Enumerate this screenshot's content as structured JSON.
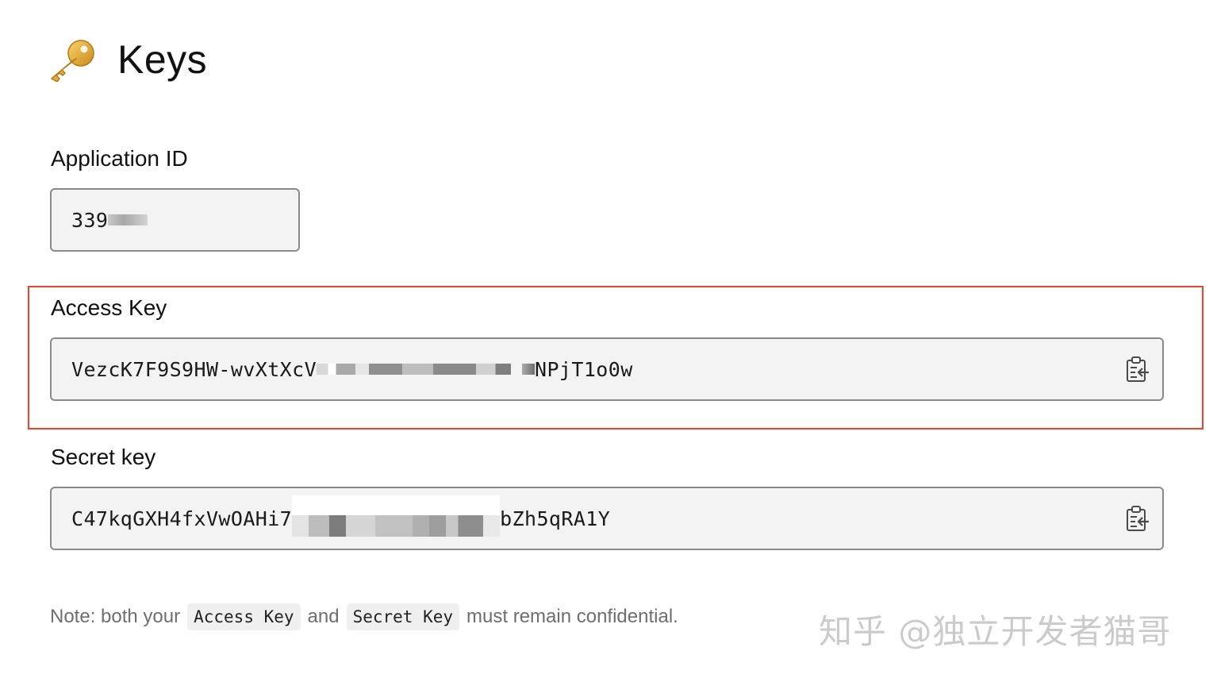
{
  "header": {
    "title": "Keys",
    "icon": "key-icon"
  },
  "application_id": {
    "label": "Application ID",
    "visible_value": "339"
  },
  "access_key": {
    "label": "Access Key",
    "value_start": "VezcK7F9S9HW-wvXtXcV",
    "value_end": "NPjT1o0w",
    "copy_icon": "clipboard-icon"
  },
  "secret_key": {
    "label": "Secret key",
    "value_start": "C47kqGXH4fxVwOAHi7",
    "value_end": "bZh5qRA1Y",
    "copy_icon": "clipboard-icon"
  },
  "note": {
    "prefix": "Note: both your",
    "code1": "Access Key",
    "middle": "and",
    "code2": "Secret Key",
    "suffix": "must remain confidential."
  },
  "watermark": "知乎 @独立开发者猫哥",
  "colors": {
    "highlight": "#e0492f",
    "field_bg": "#f3f3f3",
    "field_border": "#8a8a8a"
  }
}
